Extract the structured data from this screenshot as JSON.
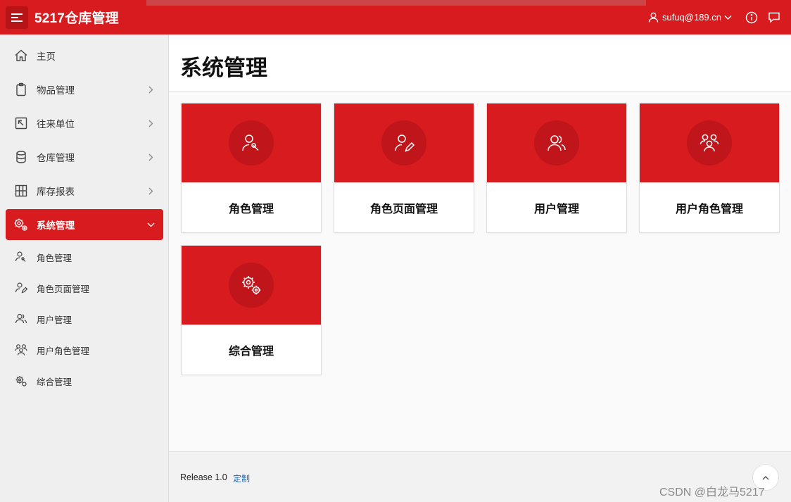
{
  "header": {
    "app_title": "5217仓库管理",
    "user_name": "sufuq@189.cn"
  },
  "sidebar": {
    "items": [
      {
        "label": "主页",
        "icon": "home-icon"
      },
      {
        "label": "物品管理",
        "icon": "clipboard-icon"
      },
      {
        "label": "往来单位",
        "icon": "arrow-box-icon"
      },
      {
        "label": "仓库管理",
        "icon": "database-icon"
      },
      {
        "label": "库存报表",
        "icon": "table-icon"
      },
      {
        "label": "系统管理",
        "icon": "gears-icon"
      }
    ],
    "subitems": [
      {
        "label": "角色管理",
        "icon": "user-wrench-icon"
      },
      {
        "label": "角色页面管理",
        "icon": "user-edit-icon"
      },
      {
        "label": "用户管理",
        "icon": "users-icon"
      },
      {
        "label": "用户角色管理",
        "icon": "user-group-icon"
      },
      {
        "label": "综合管理",
        "icon": "gear-icon"
      }
    ]
  },
  "main": {
    "page_title": "系统管理",
    "cards": [
      {
        "label": "角色管理",
        "icon": "user-wrench-icon"
      },
      {
        "label": "角色页面管理",
        "icon": "user-edit-icon"
      },
      {
        "label": "用户管理",
        "icon": "users-icon"
      },
      {
        "label": "用户角色管理",
        "icon": "user-group-icon"
      },
      {
        "label": "综合管理",
        "icon": "gears-icon"
      }
    ]
  },
  "footer": {
    "release": "Release 1.0",
    "custom_link": "定制",
    "watermark": "CSDN @白龙马5217"
  },
  "colors": {
    "brand_red": "#d81b1f",
    "brand_red_dark": "#c0151a",
    "link_blue": "#1a66b5"
  }
}
